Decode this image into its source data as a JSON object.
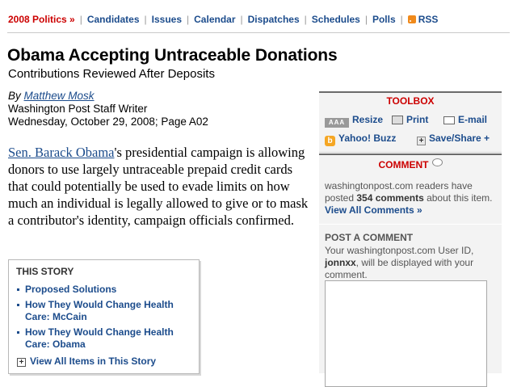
{
  "nav": {
    "section": "2008 Politics »",
    "links": [
      "Candidates",
      "Issues",
      "Calendar",
      "Dispatches",
      "Schedules",
      "Polls"
    ],
    "rss": "RSS"
  },
  "article": {
    "headline": "Obama Accepting Untraceable Donations",
    "subhead": "Contributions Reviewed After Deposits",
    "by": "By",
    "author": "Matthew Mosk",
    "role": "Washington Post Staff Writer",
    "dateline": "Wednesday, October 29, 2008; Page A02",
    "lede_link": "Sen. Barack Obama",
    "lede_text": "'s presidential campaign is allowing donors to use largely untraceable prepaid credit cards that could potentially be used to evade limits on how much an individual is legally allowed to give or to mask a contributor's identity, campaign officials confirmed."
  },
  "this_story": {
    "title": "THIS STORY",
    "items": [
      "Proposed Solutions",
      "How They Would Change Health Care: McCain",
      "How They Would Change Health Care: Obama"
    ],
    "view_all": "View All Items in This Story"
  },
  "toolbox": {
    "title": "TOOLBOX",
    "resize_glyph": "AAA",
    "resize": "Resize",
    "print": "Print",
    "email": "E-mail",
    "yahoo": "Yahoo! Buzz",
    "share": "Save/Share +"
  },
  "comment": {
    "title": "COMMENT",
    "readers_pre": "washingtonpost.com readers have posted ",
    "count": "354 comments",
    "readers_post": " about this item.",
    "view_all": "View All Comments »",
    "post_heading": "POST A COMMENT",
    "post_pre": "Your washingtonpost.com User ID, ",
    "user_id": "jonnxx",
    "post_post": ", will be displayed with your comment."
  },
  "colors": {
    "section": "#cc0000",
    "link": "#1c4c8c",
    "panel": "#f3f3f3"
  },
  "icons": [
    "rss-icon",
    "resize-icon",
    "print-icon",
    "email-icon",
    "yahoo-icon",
    "share-icon",
    "comment-bubble-icon",
    "plus-icon"
  ]
}
